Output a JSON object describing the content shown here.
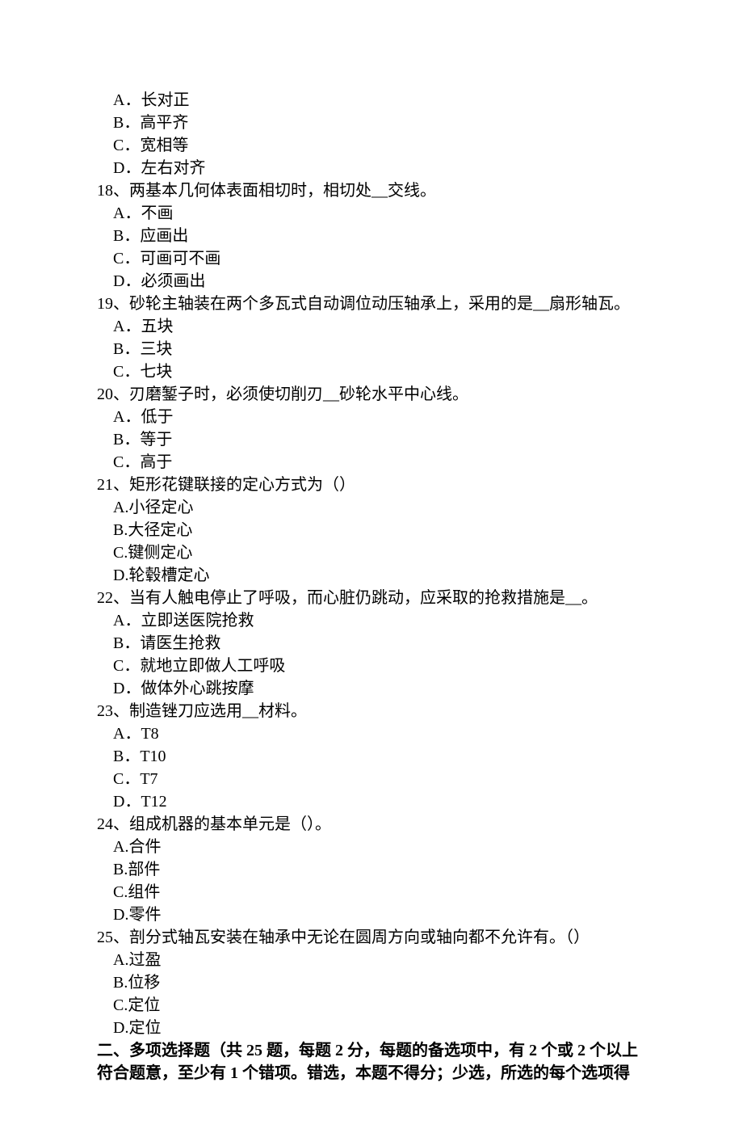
{
  "items": [
    {
      "kind": "opt",
      "text": "A．长对正"
    },
    {
      "kind": "opt",
      "text": "B．高平齐"
    },
    {
      "kind": "opt",
      "text": "C．宽相等"
    },
    {
      "kind": "opt",
      "text": "D．左右对齐"
    },
    {
      "kind": "q",
      "text": "18、两基本几何体表面相切时，相切处__交线。"
    },
    {
      "kind": "opt",
      "text": "A．不画"
    },
    {
      "kind": "opt",
      "text": "B．应画出"
    },
    {
      "kind": "opt",
      "text": "C．可画可不画"
    },
    {
      "kind": "opt",
      "text": "D．必须画出"
    },
    {
      "kind": "q",
      "text": "19、砂轮主轴装在两个多瓦式自动调位动压轴承上，采用的是__扇形轴瓦。"
    },
    {
      "kind": "opt",
      "text": "A．五块"
    },
    {
      "kind": "opt",
      "text": "B．三块"
    },
    {
      "kind": "opt",
      "text": "C．七块"
    },
    {
      "kind": "q",
      "text": "20、刃磨錾子时，必须使切削刃__砂轮水平中心线。"
    },
    {
      "kind": "opt",
      "text": "A．低于"
    },
    {
      "kind": "opt",
      "text": "B．等于"
    },
    {
      "kind": "opt",
      "text": "C．高于"
    },
    {
      "kind": "q",
      "text": "21、矩形花键联接的定心方式为（）"
    },
    {
      "kind": "opt",
      "text": "A.小径定心"
    },
    {
      "kind": "opt",
      "text": "B.大径定心"
    },
    {
      "kind": "opt",
      "text": "C.键侧定心"
    },
    {
      "kind": "opt",
      "text": "D.轮毂槽定心"
    },
    {
      "kind": "q",
      "text": "22、当有人触电停止了呼吸，而心脏仍跳动，应采取的抢救措施是__。"
    },
    {
      "kind": "opt",
      "text": "A．立即送医院抢救"
    },
    {
      "kind": "opt",
      "text": "B．请医生抢救"
    },
    {
      "kind": "opt",
      "text": "C．就地立即做人工呼吸"
    },
    {
      "kind": "opt",
      "text": "D．做体外心跳按摩"
    },
    {
      "kind": "q",
      "text": "23、制造锉刀应选用__材料。"
    },
    {
      "kind": "opt",
      "text": "A．T8"
    },
    {
      "kind": "opt",
      "text": "B．T10"
    },
    {
      "kind": "opt",
      "text": "C．T7"
    },
    {
      "kind": "opt",
      "text": "D．T12"
    },
    {
      "kind": "q",
      "text": "24、组成机器的基本单元是（）。"
    },
    {
      "kind": "opt",
      "text": "A.合件"
    },
    {
      "kind": "opt",
      "text": "B.部件"
    },
    {
      "kind": "opt",
      "text": "C.组件"
    },
    {
      "kind": "opt",
      "text": "D.零件"
    },
    {
      "kind": "q",
      "text": "25、剖分式轴瓦安装在轴承中无论在圆周方向或轴向都不允许有。（）"
    },
    {
      "kind": "opt",
      "text": "A.过盈"
    },
    {
      "kind": "opt",
      "text": "B.位移"
    },
    {
      "kind": "opt",
      "text": "C.定位"
    },
    {
      "kind": "opt",
      "text": "D.定位"
    },
    {
      "kind": "hdr",
      "text": "二、多项选择题（共 25 题，每题 2 分，每题的备选项中，有 2 个或 2 个以上符合题意，至少有 1 个错项。错选，本题不得分；少选，所选的每个选项得"
    }
  ]
}
